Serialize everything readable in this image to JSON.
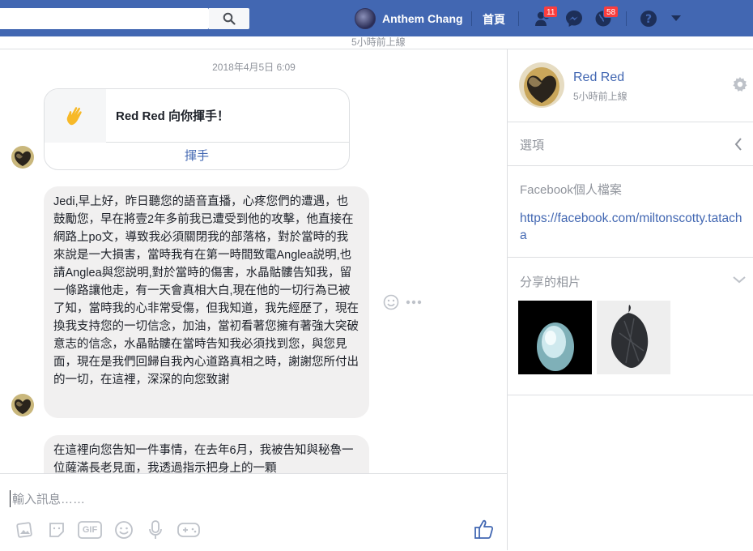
{
  "topbar": {
    "user_name": "Anthem Chang",
    "home_label": "首頁",
    "friend_requests_count": "11",
    "notifications_count": "58",
    "under_status": "5小時前上線"
  },
  "chat": {
    "date": "2018年4月5日 6:09",
    "wave": {
      "text": "Red Red 向你揮手！",
      "action": "揮手"
    },
    "message1": "Jedi,早上好，昨日聽您的語音直播，心疼您們的遭遇，也鼓勵您，早在將壹2年多前我已遭受到他的攻擊，他直接在網路上po文，導致我必須關閉我的部落格，對於當時的我來說是一大損害，當時我有在第一時間致電Anglea説明,也請Anglea與您説明,對於當時的傷害，水晶骷髏告知我，留一條路讓他走，有一天會真相大白,現在他的一切行為已被了知，當時我的心非常受傷，但我知道，我先經歷了，現在換我支持您的一切信念，加油，當初看著您擁有著強大突破意志的信念，水晶骷髏在當時告知我必須找到您，與您見面，現在是我們回歸自我內心道路真相之時，謝謝您所付出的一切，在這裡，深深的向您致謝",
    "message2": "在這裡向您告知一件事情，在去年6月，我被告知與秘魯一位薩滿長老見面，我透過指示把身上的一顆",
    "composer_placeholder": "輸入訊息……",
    "toolbar": {
      "gif_label": "GIF"
    }
  },
  "sidebar": {
    "contact_name": "Red Red",
    "contact_status": "5小時前上線",
    "options_label": "選項",
    "profile_label": "Facebook個人檔案",
    "profile_url": "https://facebook.com/miltonscotty.tatacha",
    "shared_photos_label": "分享的相片"
  },
  "colors": {
    "brand": "#4267b2",
    "badge": "#fa3e3e",
    "bubble": "#f1f0f0",
    "muted": "#90949c"
  }
}
